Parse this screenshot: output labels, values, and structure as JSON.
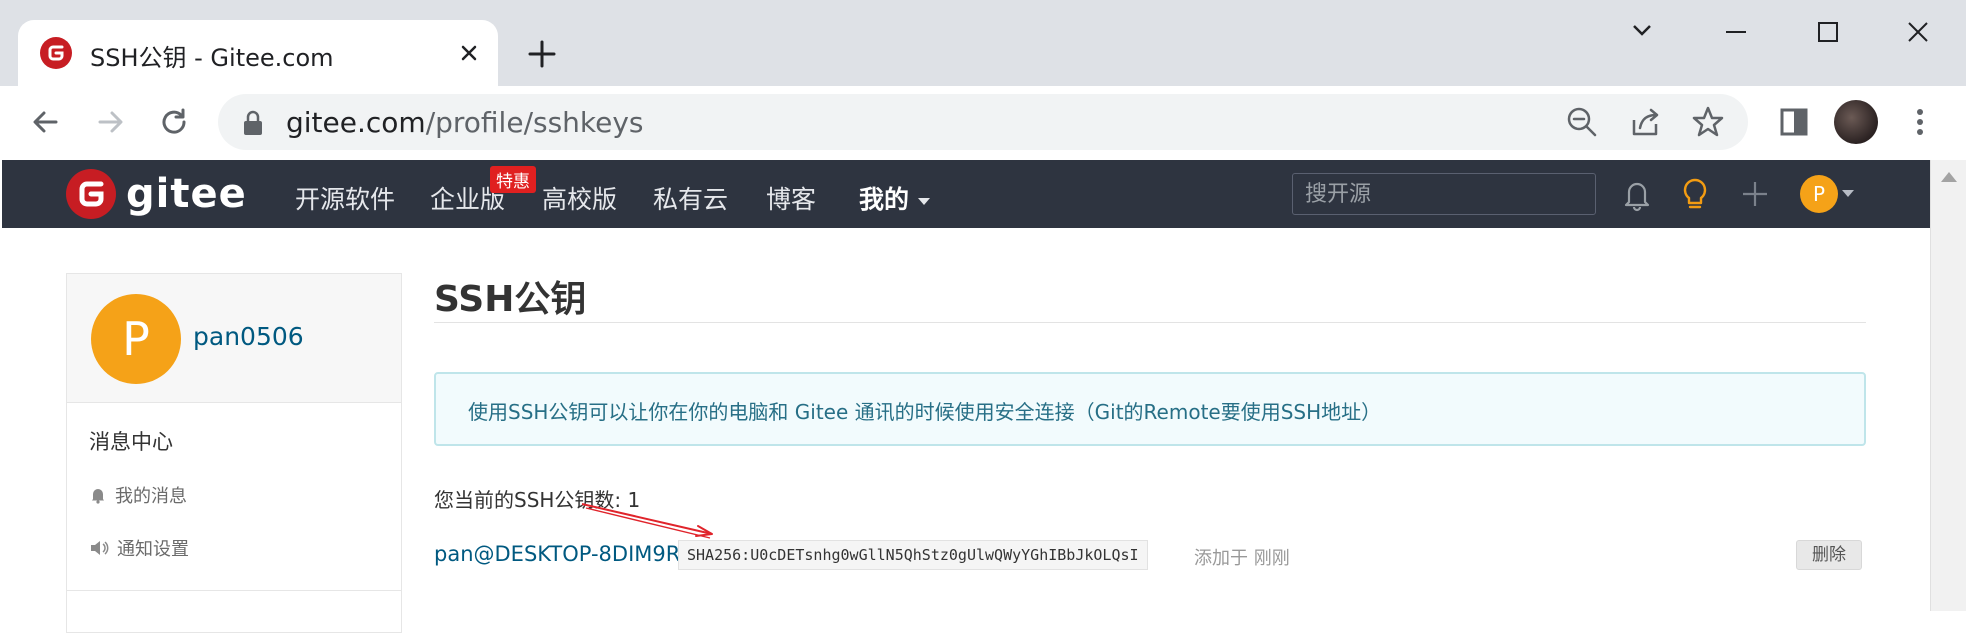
{
  "browser": {
    "tab_title": "SSH公钥 - Gitee.com",
    "url_host": "gitee.com",
    "url_path": "/profile/sshkeys"
  },
  "nav": {
    "logo_text": "gitee",
    "items": [
      "开源软件",
      "企业版",
      "高校版",
      "私有云",
      "博客",
      "我的"
    ],
    "badge": "特惠",
    "search_placeholder": "搜开源",
    "user_initial": "P"
  },
  "sidebar": {
    "avatar_initial": "P",
    "username": "pan0506",
    "section_title": "消息中心",
    "links": [
      "我的消息",
      "通知设置"
    ]
  },
  "main": {
    "title": "SSH公钥",
    "info": "使用SSH公钥可以让你在你的电脑和 Gitee 通讯的时候使用安全连接（Git的Remote要使用SSH地址）",
    "count_text": "您当前的SSH公钥数: 1",
    "keys": [
      {
        "name": "pan@DESKTOP-8DIM9R8",
        "fingerprint": "SHA256:U0cDETsnhg0wGllN5QhStz0gUlwQWyYGhIBbJkOLQsI",
        "added": "添加于 刚刚",
        "delete_label": "删除"
      }
    ]
  },
  "colors": {
    "nav_bg": "#2e3440",
    "brand_red": "#c71d23",
    "avatar_orange": "#f5a218",
    "link_blue": "#005980"
  }
}
